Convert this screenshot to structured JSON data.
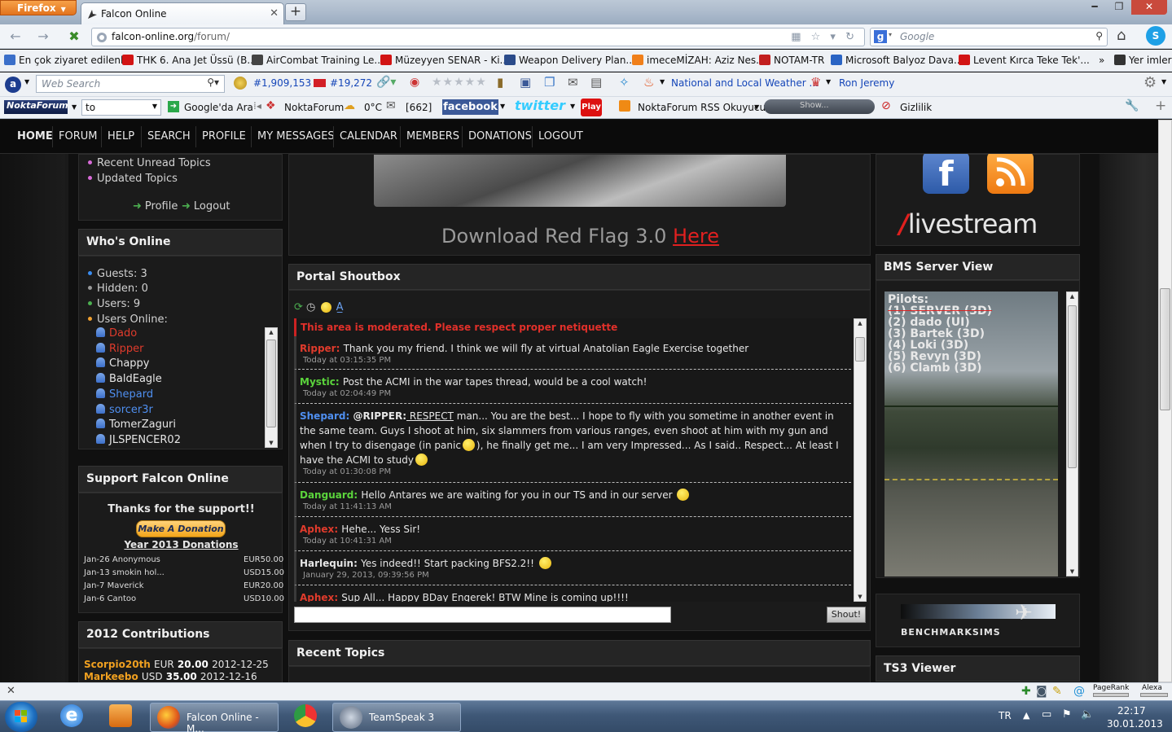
{
  "browser": {
    "app_button": "Firefox",
    "tab_title": "Firefox",
    "tab_label": "Falcon Online",
    "url_host": "falcon-online.org",
    "url_path": "/forum/",
    "search_placeholder": "Google"
  },
  "bookmarks": [
    "En çok ziyaret edilenler",
    "THK 6. Ana Jet Üssü (B...",
    "AirCombat Training Le...",
    "Müzeyyen SENAR - Ki...",
    "Weapon Delivery Plan...",
    "imeceMİZAH: Aziz Nes...",
    "NOTAM-TR",
    "Microsoft Balyoz Dava...",
    "Levent Kırca Teke Tek'...",
    "Yer imleri"
  ],
  "toolbar1": {
    "web_search_placeholder": "Web Search",
    "rank_global": "#1,909,153",
    "rank_country": "#19,272",
    "weather": "National and Local Weather ...",
    "user": "Ron Jeremy"
  },
  "toolbar2": {
    "to_value": "to",
    "google_search": "Google'da Ara",
    "noktaforum": "NoktaForum",
    "temp": "0°C",
    "mail_count": "[662]",
    "facebook": "facebook",
    "twitter": "twitter",
    "play": "Play",
    "rss_reader": "NoktaForum RSS Okuyucu",
    "show": "Show...",
    "privacy": "Gizlilik"
  },
  "menu": [
    "HOME",
    "FORUM",
    "HELP",
    "SEARCH",
    "PROFILE",
    "MY MESSAGES",
    "CALENDAR",
    "MEMBERS",
    "DONATIONS",
    "LOGOUT"
  ],
  "left": {
    "links": [
      "Recent Unread Topics",
      "Updated Topics"
    ],
    "profile": "Profile",
    "logout": "Logout",
    "whos_online_title": "Who's Online",
    "stats": [
      "Guests: 3",
      "Hidden: 0",
      "Users: 9",
      "Users Online:"
    ],
    "users": [
      {
        "name": "Dado",
        "color": "#e03b2c"
      },
      {
        "name": "Ripper",
        "color": "#e03b2c"
      },
      {
        "name": "Chappy",
        "color": "#e6e6e6"
      },
      {
        "name": "BaldEagle",
        "color": "#e6e6e6"
      },
      {
        "name": "Shepard",
        "color": "#4f8ff0"
      },
      {
        "name": "sorcer3r",
        "color": "#4f8ff0"
      },
      {
        "name": "TomerZaguri",
        "color": "#e6e6e6"
      },
      {
        "name": "JLSPENCER02",
        "color": "#e6e6e6"
      }
    ],
    "support_title": "Support Falcon Online",
    "thanks": "Thanks for the support!!",
    "donate_button": "Make A Donation",
    "year_donations": "Year 2013 Donations",
    "donations": [
      {
        "d": "Jan-26 Anonymous",
        "a": "EUR50.00"
      },
      {
        "d": "Jan-13 smokin hol...",
        "a": "USD15.00"
      },
      {
        "d": "Jan-7 Maverick",
        "a": "EUR20.00"
      },
      {
        "d": "Jan-6 Cantoo",
        "a": "USD10.00"
      }
    ],
    "contrib_title": "2012 Contributions",
    "contributions": [
      {
        "name": "Scorpio20th",
        "cur": "EUR",
        "amt": "20.00",
        "date": "2012-12-25"
      },
      {
        "name": "Markeebo",
        "cur": "USD",
        "amt": "35.00",
        "date": "2012-12-16"
      }
    ]
  },
  "center": {
    "download_text": "Download Red Flag 3.0",
    "download_link": "Here",
    "shoutbox_title": "Portal Shoutbox",
    "moderated": "This area is moderated. Please respect proper netiquette",
    "messages": [
      {
        "name": "Ripper",
        "color": "#e03b2c",
        "text": "Thank you my friend. I think we will fly at virtual Anatolian Eagle Exercise together",
        "time": "Today at 03:15:35 PM"
      },
      {
        "name": "Mystic",
        "color": "#5bd43c",
        "text": "Post the ACMI in the war tapes thread, would be a cool watch!",
        "time": "Today at 02:04:49 PM"
      },
      {
        "name": "Shepard",
        "color": "#4f8ff0",
        "prefix": "@RIPPER:",
        "underlined": " RESPECT",
        "text1": " man... You are the best... I hope to fly with you sometime in another event in the same team. Guys I shoot at him, six slammers from various ranges, even shoot at him with my gun and when I try to disengage (in panic",
        "text2": "), he finally get me... I am very Impressed... As I said.. Respect... At least I have the ACMI to study",
        "time": "Today at 01:30:08 PM"
      },
      {
        "name": "Danguard",
        "color": "#5bd43c",
        "text": "Hello Antares we are waiting for you in our TS and in our server",
        "time": "Today at 11:41:13 AM"
      },
      {
        "name": "Aphex",
        "color": "#e03b2c",
        "text": "Hehe... Yess Sir!",
        "time": "Today at 10:41:31 AM"
      },
      {
        "name": "Harlequin",
        "color": "#e6e6e6",
        "text": "Yes indeed!!  Start packing BFS2.2!!",
        "time": "January 29, 2013, 09:39:56 PM"
      },
      {
        "name": "Aphex",
        "color": "#e03b2c",
        "text": "Sup All... Happy BDay Engerek! BTW Mine is coming up!!!!",
        "time": ""
      }
    ],
    "shout_button": "Shout!",
    "recent_topics_title": "Recent Topics"
  },
  "right": {
    "livestream": "livestream",
    "bms_title": "BMS Server View",
    "pilots_label": "Pilots:",
    "pilots": [
      "(1) SERVER (3D)",
      "(2) dado (UI)",
      "(3) Bartek (3D)",
      "(4) Loki (3D)",
      "(5) Revyn (3D)",
      "(6) Clamb (3D)"
    ],
    "benchmark": "BENCHMARKSIMS",
    "ts3_title": "TS3 Viewer"
  },
  "status": {
    "pagerank": "PageRank",
    "alexa": "Alexa"
  },
  "taskbar": {
    "firefox_task": "Falcon Online - M...",
    "ts_task": "TeamSpeak 3",
    "lang": "TR",
    "time": "22:17",
    "date": "30.01.2013"
  }
}
